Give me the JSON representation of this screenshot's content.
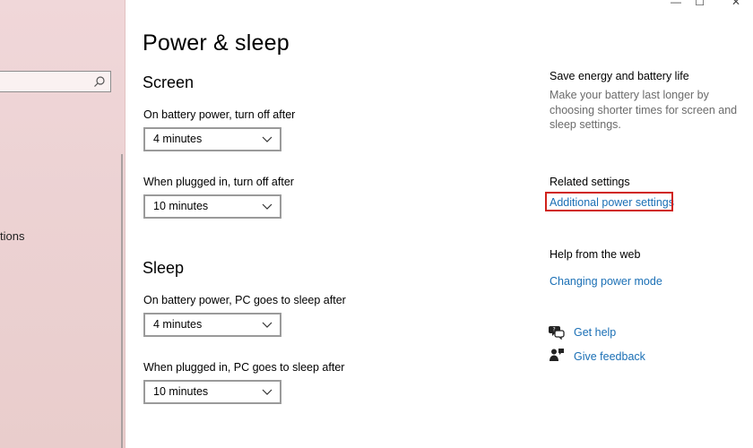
{
  "window": {
    "controls": [
      "—",
      "☐",
      "✕"
    ]
  },
  "sidebar": {
    "search_placeholder": "",
    "partial_label": "tions"
  },
  "page": {
    "title": "Power & sleep"
  },
  "screen": {
    "title": "Screen",
    "battery_label": "On battery power, turn off after",
    "battery_value": "4 minutes",
    "plugged_label": "When plugged in, turn off after",
    "plugged_value": "10 minutes"
  },
  "sleep": {
    "title": "Sleep",
    "battery_label": "On battery power, PC goes to sleep after",
    "battery_value": "4 minutes",
    "plugged_label": "When plugged in, PC goes to sleep after",
    "plugged_value": "10 minutes"
  },
  "right": {
    "save_title": "Save energy and battery life",
    "save_desc": "Make your battery last longer by choosing shorter times for screen and sleep settings.",
    "related_title": "Related settings",
    "related_link": "Additional power settings",
    "web_title": "Help from the web",
    "web_link": "Changing power mode",
    "get_help": "Get help",
    "give_feedback": "Give feedback"
  },
  "colors": {
    "link": "#1a6fb5",
    "highlight": "#d0221b",
    "sidebar": "#ecd2d3"
  }
}
